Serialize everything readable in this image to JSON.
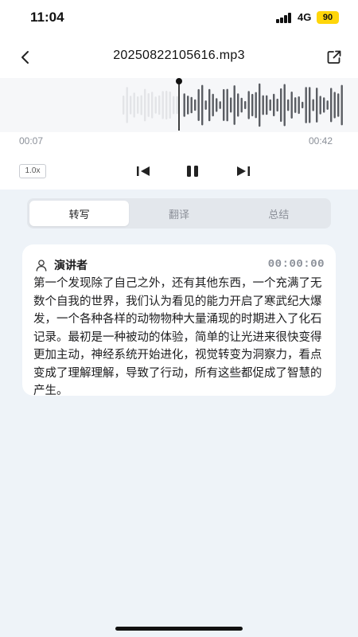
{
  "status_bar": {
    "time": "11:04",
    "network": "4G",
    "battery": "90"
  },
  "nav": {
    "title": "20250822105616.mp3",
    "back_icon": "chevron-left-icon",
    "share_icon": "share-icon"
  },
  "player": {
    "current_time": "00:07",
    "total_time": "00:42",
    "speed": "1.0x",
    "progress": 0.17,
    "state": "playing"
  },
  "tabs": [
    {
      "label": "转写",
      "active": true
    },
    {
      "label": "翻译",
      "active": false
    },
    {
      "label": "总结",
      "active": false
    }
  ],
  "transcript": {
    "speaker": "演讲者",
    "timestamp": "00:00:00",
    "text": "第一个发现除了自己之外，还有其他东西，一个充满了无数个自我的世界，我们认为看见的能力开启了寒武纪大爆发，一个各种各样的动物物种大量涌现的时期进入了化石记录。最初是一种被动的体验，简单的让光进来很快变得更加主动，神经系统开始进化，视觉转变为洞察力，看点变成了理解理解，导致了行动，所有这些都促成了智慧的产生。"
  },
  "colors": {
    "accent": "#1d1d1f",
    "waveform_played": "#e3e4e7",
    "waveform_unplayed": "#5a5d63",
    "battery": "#ffd60a"
  }
}
